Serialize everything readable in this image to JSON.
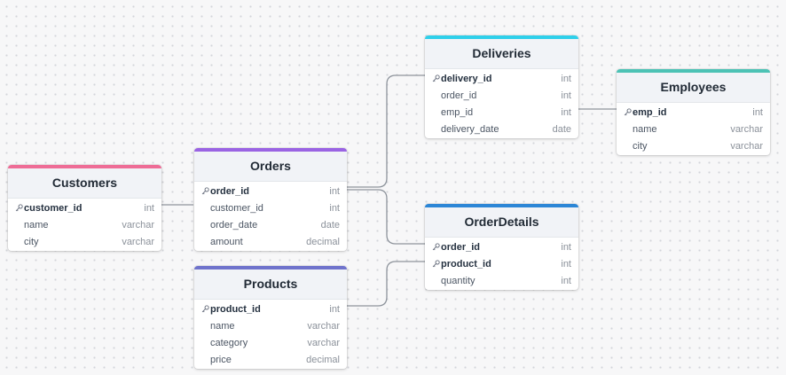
{
  "colors": {
    "customers": "#ee6c96",
    "orders": "#9a63e3",
    "products": "#6f73cc",
    "deliveries": "#2fd0ea",
    "employees": "#4cc2b5",
    "orderdetails": "#2c86d6"
  },
  "icons": {
    "key": "key-icon"
  },
  "tables": {
    "customers": {
      "title": "Customers",
      "fields": [
        {
          "name": "customer_id",
          "type": "int",
          "pk": true
        },
        {
          "name": "name",
          "type": "varchar",
          "pk": false
        },
        {
          "name": "city",
          "type": "varchar",
          "pk": false
        }
      ]
    },
    "orders": {
      "title": "Orders",
      "fields": [
        {
          "name": "order_id",
          "type": "int",
          "pk": true
        },
        {
          "name": "customer_id",
          "type": "int",
          "pk": false
        },
        {
          "name": "order_date",
          "type": "date",
          "pk": false
        },
        {
          "name": "amount",
          "type": "decimal",
          "pk": false
        }
      ]
    },
    "products": {
      "title": "Products",
      "fields": [
        {
          "name": "product_id",
          "type": "int",
          "pk": true
        },
        {
          "name": "name",
          "type": "varchar",
          "pk": false
        },
        {
          "name": "category",
          "type": "varchar",
          "pk": false
        },
        {
          "name": "price",
          "type": "decimal",
          "pk": false
        }
      ]
    },
    "deliveries": {
      "title": "Deliveries",
      "fields": [
        {
          "name": "delivery_id",
          "type": "int",
          "pk": true
        },
        {
          "name": "order_id",
          "type": "int",
          "pk": false
        },
        {
          "name": "emp_id",
          "type": "int",
          "pk": false
        },
        {
          "name": "delivery_date",
          "type": "date",
          "pk": false
        }
      ]
    },
    "employees": {
      "title": "Employees",
      "fields": [
        {
          "name": "emp_id",
          "type": "int",
          "pk": true
        },
        {
          "name": "name",
          "type": "varchar",
          "pk": false
        },
        {
          "name": "city",
          "type": "varchar",
          "pk": false
        }
      ]
    },
    "orderdetails": {
      "title": "OrderDetails",
      "fields": [
        {
          "name": "order_id",
          "type": "int",
          "pk": true
        },
        {
          "name": "product_id",
          "type": "int",
          "pk": true
        },
        {
          "name": "quantity",
          "type": "int",
          "pk": false
        }
      ]
    }
  },
  "relationships": [
    {
      "from": "customers.customer_id",
      "to": "orders.customer_id"
    },
    {
      "from": "orders.order_id",
      "to": "deliveries.order_id"
    },
    {
      "from": "orders.order_id",
      "to": "orderdetails.order_id"
    },
    {
      "from": "products.product_id",
      "to": "orderdetails.product_id"
    },
    {
      "from": "deliveries.emp_id",
      "to": "employees.emp_id"
    }
  ]
}
